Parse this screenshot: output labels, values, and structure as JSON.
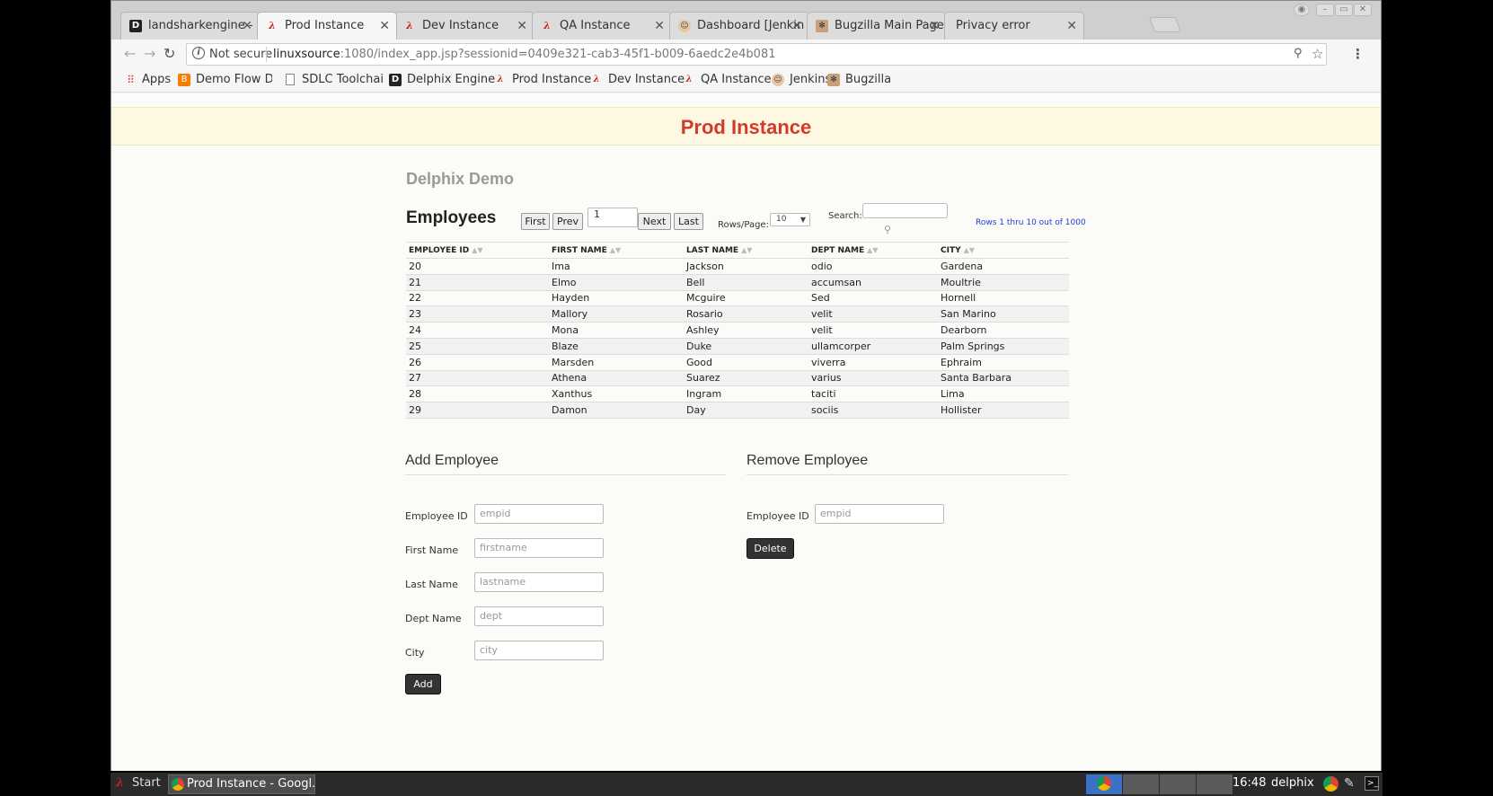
{
  "browser": {
    "tabs": [
      {
        "title": "landsharkengine -",
        "icon": "delphix-icon",
        "active": false
      },
      {
        "title": "Prod Instance",
        "icon": "lambda-icon",
        "active": true
      },
      {
        "title": "Dev Instance",
        "icon": "lambda-icon",
        "active": false
      },
      {
        "title": "QA Instance",
        "icon": "lambda-icon",
        "active": false
      },
      {
        "title": "Dashboard [Jenkin",
        "icon": "jenkins-icon",
        "active": false
      },
      {
        "title": "Bugzilla Main Page",
        "icon": "bugzilla-icon",
        "active": false
      },
      {
        "title": "Privacy error",
        "icon": "none",
        "active": false
      }
    ],
    "address": {
      "security_label": "Not secure",
      "host": "linuxsource",
      "rest": ":1080/index_app.jsp?sessionid=0409e321-cab3-45f1-b009-6aedc2e4b081"
    },
    "bookmarks": [
      {
        "label": "Apps",
        "icon": "apps-grid-icon"
      },
      {
        "label": "Demo Flow Diag",
        "icon": "blogger-icon"
      },
      {
        "label": "SDLC Toolchain",
        "icon": "document-icon"
      },
      {
        "label": "Delphix Engine",
        "icon": "delphix-icon"
      },
      {
        "label": "Prod Instance",
        "icon": "lambda-icon"
      },
      {
        "label": "Dev Instance",
        "icon": "lambda-icon"
      },
      {
        "label": "QA Instance",
        "icon": "lambda-icon"
      },
      {
        "label": "Jenkins",
        "icon": "jenkins-icon"
      },
      {
        "label": "Bugzilla",
        "icon": "bugzilla-icon"
      }
    ]
  },
  "page": {
    "banner_title": "Prod Instance",
    "demo_title": "Delphix Demo",
    "employees_heading": "Employees",
    "pager": {
      "first": "First",
      "prev": "Prev",
      "page_value": "1",
      "next": "Next",
      "last": "Last",
      "rows_label": "Rows/Page:",
      "rows_value": "10",
      "search_label": "Search:",
      "rows_info": "Rows 1 thru 10 out of 1000"
    },
    "table": {
      "columns": [
        "EMPLOYEE ID",
        "FIRST NAME",
        "LAST NAME",
        "DEPT NAME",
        "CITY"
      ],
      "rows": [
        [
          "20",
          "Ima",
          "Jackson",
          "odio",
          "Gardena"
        ],
        [
          "21",
          "Elmo",
          "Bell",
          "accumsan",
          "Moultrie"
        ],
        [
          "22",
          "Hayden",
          "Mcguire",
          "Sed",
          "Hornell"
        ],
        [
          "23",
          "Mallory",
          "Rosario",
          "velit",
          "San Marino"
        ],
        [
          "24",
          "Mona",
          "Ashley",
          "velit",
          "Dearborn"
        ],
        [
          "25",
          "Blaze",
          "Duke",
          "ullamcorper",
          "Palm Springs"
        ],
        [
          "26",
          "Marsden",
          "Good",
          "viverra",
          "Ephraim"
        ],
        [
          "27",
          "Athena",
          "Suarez",
          "varius",
          "Santa Barbara"
        ],
        [
          "28",
          "Xanthus",
          "Ingram",
          "taciti",
          "Lima"
        ],
        [
          "29",
          "Damon",
          "Day",
          "sociis",
          "Hollister"
        ]
      ]
    },
    "add_employee": {
      "title": "Add Employee",
      "fields": [
        {
          "label": "Employee ID",
          "placeholder": "empid"
        },
        {
          "label": "First Name",
          "placeholder": "firstname"
        },
        {
          "label": "Last Name",
          "placeholder": "lastname"
        },
        {
          "label": "Dept Name",
          "placeholder": "dept"
        },
        {
          "label": "City",
          "placeholder": "city"
        }
      ],
      "button": "Add"
    },
    "remove_employee": {
      "title": "Remove Employee",
      "field": {
        "label": "Employee ID",
        "placeholder": "empid"
      },
      "button": "Delete"
    }
  },
  "taskbar": {
    "start": "Start",
    "task": "Prod Instance - Googl...",
    "clock": "16:48",
    "user": "delphix"
  }
}
